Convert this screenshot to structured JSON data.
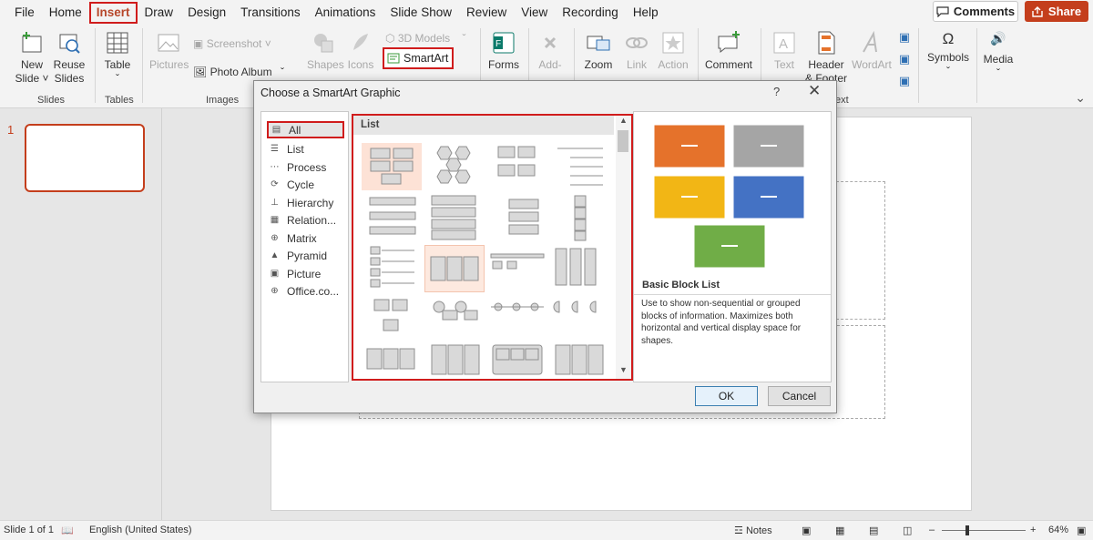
{
  "menu": [
    "File",
    "Home",
    "Insert",
    "Draw",
    "Design",
    "Transitions",
    "Animations",
    "Slide Show",
    "Review",
    "View",
    "Recording",
    "Help"
  ],
  "active_tab": "Insert",
  "comments_label": "Comments",
  "share_label": "Share",
  "ribbon": {
    "new_slide": [
      "New",
      "Slide ˅"
    ],
    "reuse_slides": [
      "Reuse",
      "Slides"
    ],
    "slides_group": "Slides",
    "table": "Table",
    "tables_group": "Tables",
    "pictures": "Pictures",
    "screenshot": "Screenshot ˅",
    "photo_album": "Photo Album",
    "images_group": "Images",
    "shapes": "Shapes",
    "icons": "Icons",
    "models_3d": "3D Models",
    "smartart": "SmartArt",
    "forms": "Forms",
    "addins": "Add-",
    "zoom": "Zoom",
    "link": "Link",
    "action": "Action",
    "comment": "Comment",
    "text_box": "Text",
    "header_footer": [
      "Header",
      "& Footer"
    ],
    "wordart": "WordArt",
    "text_group_tail": "ext",
    "symbols": "Symbols",
    "media": "Media"
  },
  "thumb_number": "1",
  "dialog": {
    "title": "Choose a SmartArt Graphic",
    "help": "?",
    "close": "✕",
    "categories": [
      "All",
      "List",
      "Process",
      "Cycle",
      "Hierarchy",
      "Relation...",
      "Matrix",
      "Pyramid",
      "Picture",
      "Office.co..."
    ],
    "selected_category": "All",
    "gallery_heading": "List",
    "preview_name": "Basic Block List",
    "preview_description": "Use to show non-sequential or grouped blocks of information. Maximizes both horizontal and vertical display space for shapes.",
    "ok": "OK",
    "cancel": "Cancel"
  },
  "preview_colors": [
    "#e5722b",
    "#a5a5a5",
    "#f2b615",
    "#4472c4",
    "#70ad47"
  ],
  "status": {
    "slide_info": "Slide 1 of 1",
    "language": "English (United States)",
    "notes": "Notes",
    "zoom": "64%"
  }
}
